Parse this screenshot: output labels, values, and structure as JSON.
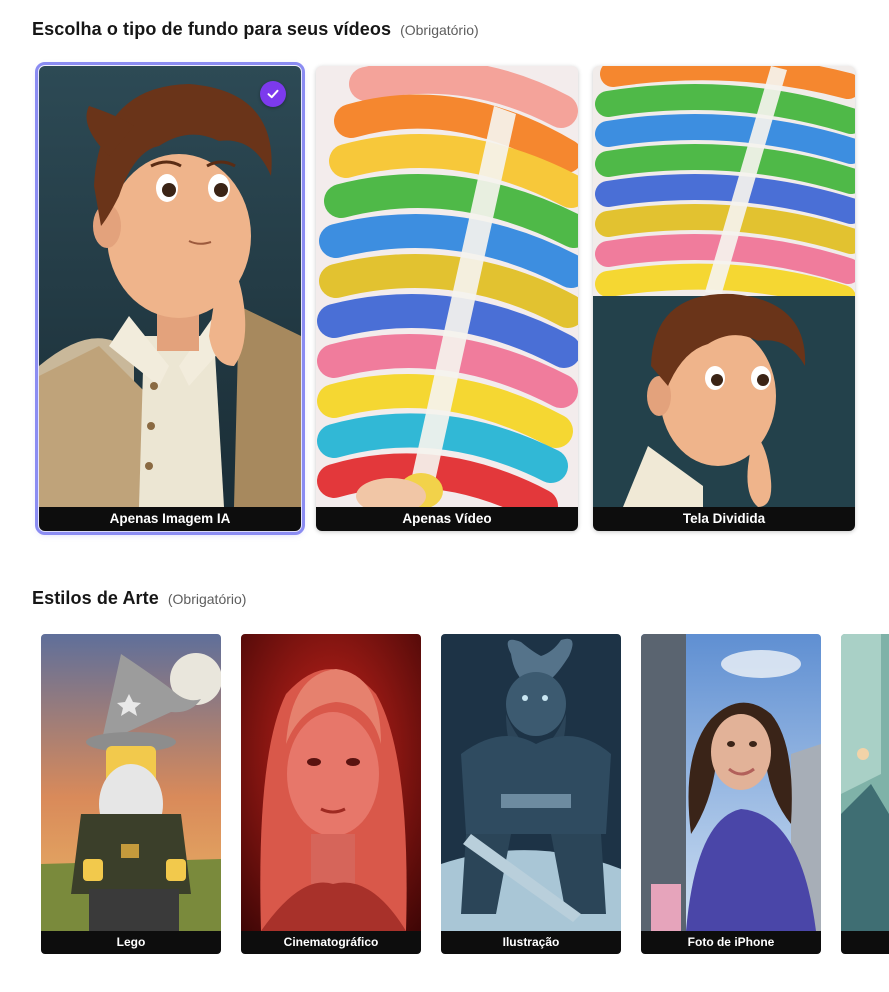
{
  "background_section": {
    "title": "Escolha o tipo de fundo para seus vídeos",
    "required": "(Obrigatório)",
    "options": [
      {
        "label": "Apenas Imagem IA",
        "selected": true,
        "thumbnail": "cartoon-boy-thinking"
      },
      {
        "label": "Apenas Vídeo",
        "selected": false,
        "thumbnail": "rainbow-jelly-slicing"
      },
      {
        "label": "Tela Dividida",
        "selected": false,
        "thumbnail": "split-jelly-and-cartoon-boy"
      }
    ]
  },
  "art_section": {
    "title": "Estilos de Arte",
    "required": "(Obrigatório)",
    "styles": [
      {
        "label": "Lego",
        "thumbnail": "lego-wizard"
      },
      {
        "label": "Cinematográfico",
        "thumbnail": "red-lit-portrait"
      },
      {
        "label": "Ilustração",
        "thumbnail": "viking-warrior-illustration"
      },
      {
        "label": "Foto de iPhone",
        "thumbnail": "selfie-city-street"
      },
      {
        "label": "",
        "thumbnail": "partially-visible-cartoon"
      }
    ]
  },
  "colors": {
    "accent": "#7c3aed",
    "selected_outline": "#8b8cf2",
    "label_bar": "#0d0d0d"
  },
  "icons": {
    "selected_check": "check-icon"
  }
}
